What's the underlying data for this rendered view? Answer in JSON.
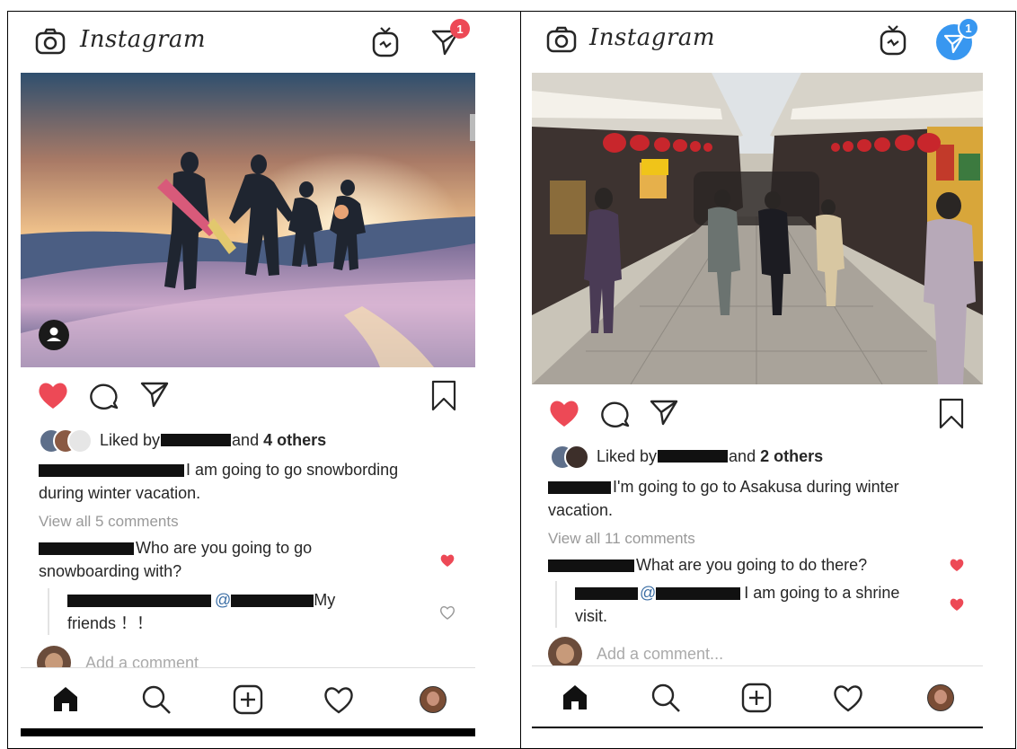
{
  "left": {
    "app_name": "Instagram",
    "dm_badge": "1",
    "liked_prefix": "Liked by",
    "liked_suffix": "and",
    "liked_others": "4 others",
    "caption_line1": "I am going to go snowbording",
    "caption_line2": "during winter vacation.",
    "view_comments": "View all 5 comments",
    "comment1_line1": "Who are you going to go",
    "comment1_line2": "snowboarding with?",
    "reply_mention": "@",
    "reply_text": "My",
    "reply_line2": "friends ！！",
    "add_comment": "Add a comment"
  },
  "right": {
    "app_name": "Instagram",
    "dm_badge": "1",
    "liked_prefix": "Liked by",
    "liked_suffix": "and",
    "liked_others": "2 others",
    "caption_line1": "I'm going to go to Asakusa during winter",
    "caption_line2": "vacation.",
    "view_comments": "View all 11 comments",
    "comment1_text": "What are you going to do there?",
    "reply_mention": "@",
    "reply_text": "I am going to a shrine",
    "reply_line2": "visit.",
    "add_comment": "Add a comment..."
  },
  "colors": {
    "heart_red": "#ed4956",
    "badge_red": "#ed4956",
    "badge_blue": "#3897f0",
    "mention_blue": "#3b6ea5"
  }
}
